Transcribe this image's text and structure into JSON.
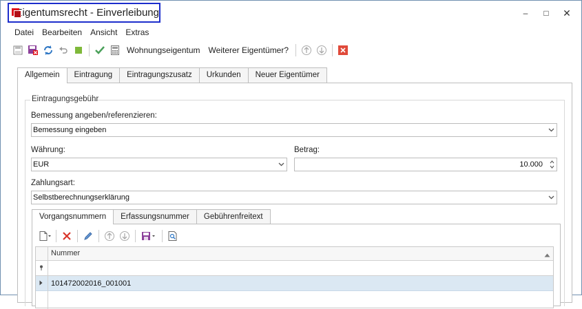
{
  "window": {
    "title": "Eigentumsrecht - Einverleibung",
    "controls": {
      "minimize": "–",
      "maximize": "□",
      "close": "✕"
    }
  },
  "menu": [
    "Datei",
    "Bearbeiten",
    "Ansicht",
    "Extras"
  ],
  "toolbar": {
    "wohnungseigentum": "Wohnungseigentum",
    "weiterer": "Weiterer Eigentümer?"
  },
  "tabs": [
    "Allgemein",
    "Eintragung",
    "Eintragungszusatz",
    "Urkunden",
    "Neuer Eigentümer"
  ],
  "group": {
    "title": "Eintragungsgebühr",
    "bemessung_label": "Bemessung angeben/referenzieren:",
    "bemessung_value": "Bemessung eingeben",
    "waehrung_label": "Währung:",
    "waehrung_value": "EUR",
    "betrag_label": "Betrag:",
    "betrag_value": "10.000",
    "zahlungsart_label": "Zahlungsart:",
    "zahlungsart_value": "Selbstberechnungserklärung"
  },
  "subtabs": [
    "Vorgangsnummern",
    "Erfassungsnummer",
    "Gebührenfreitext"
  ],
  "grid": {
    "column": "Nummer",
    "rows": [
      "101472002016_001001"
    ]
  },
  "colors": {
    "accent_blue": "#1c2dcc",
    "brand_red": "#e0141c",
    "row_selected": "#dbe8f3"
  }
}
